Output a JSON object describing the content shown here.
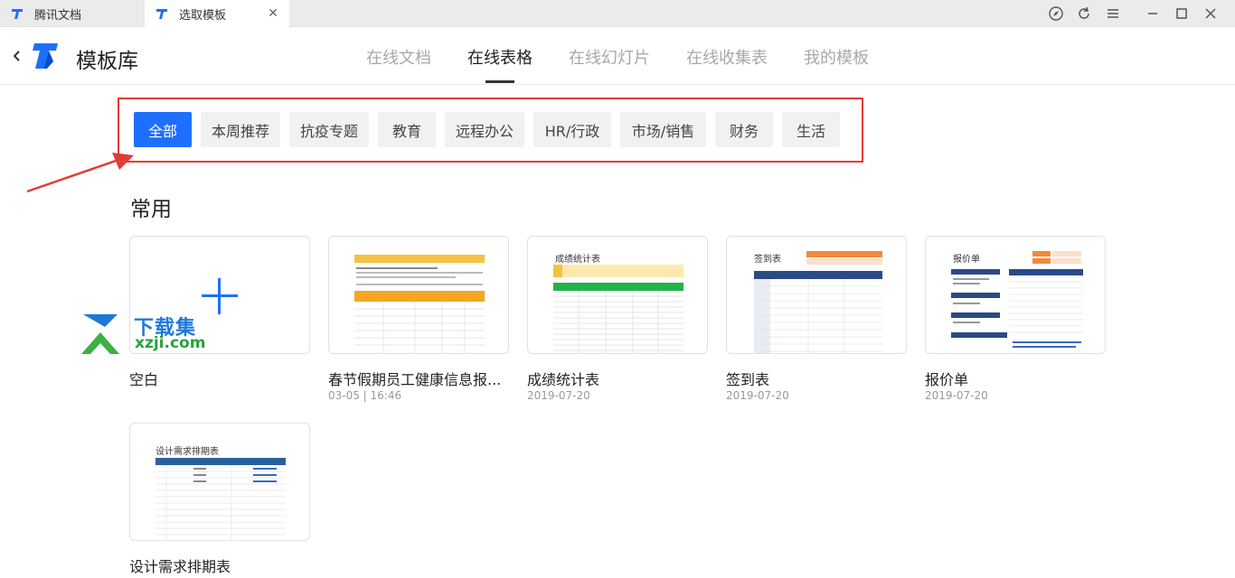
{
  "titlebar": {
    "tabs": [
      {
        "label": "腾讯文档"
      },
      {
        "label": "选取模板"
      }
    ]
  },
  "header": {
    "title": "模板库",
    "nav": [
      "在线文档",
      "在线表格",
      "在线幻灯片",
      "在线收集表",
      "我的模板"
    ],
    "active_nav": "在线表格"
  },
  "categories": [
    "全部",
    "本周推荐",
    "抗疫专题",
    "教育",
    "远程办公",
    "HR/行政",
    "市场/销售",
    "财务",
    "生活"
  ],
  "active_category": "全部",
  "section": {
    "title": "常用",
    "templates": [
      {
        "name": "空白",
        "date": ""
      },
      {
        "name": "春节假期员工健康信息报...",
        "date": "03-05 | 16:46"
      },
      {
        "name": "成绩统计表",
        "date": "2019-07-20"
      },
      {
        "name": "签到表",
        "date": "2019-07-20"
      },
      {
        "name": "报价单",
        "date": "2019-07-20"
      },
      {
        "name": "设计需求排期表",
        "date": ""
      }
    ]
  },
  "thumbs": {
    "chengji_title": "成绩统计表",
    "qiandao_title": "签到表",
    "baojia_title": "报价单",
    "sheji_title": "设计需求排期表"
  },
  "watermark": {
    "line1": "下载集",
    "line2": "xzji.com"
  },
  "colors": {
    "accent": "#1e6fff",
    "highlight": "#e53935"
  }
}
